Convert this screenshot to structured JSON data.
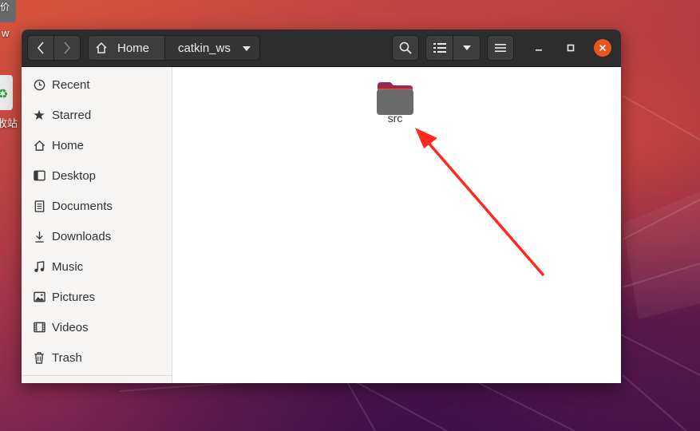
{
  "desktop": {
    "partial_label_top": "w",
    "partial_label_trash": "收站",
    "partial_label_top_glyph": "价"
  },
  "window": {
    "breadcrumb": [
      {
        "label": "Home"
      },
      {
        "label": "catkin_ws"
      }
    ],
    "accent_color": "#e95420"
  },
  "sidebar": {
    "items": [
      {
        "label": "Recent",
        "icon": "clock-icon"
      },
      {
        "label": "Starred",
        "icon": "star-icon"
      },
      {
        "label": "Home",
        "icon": "home-icon"
      },
      {
        "label": "Desktop",
        "icon": "desktop-icon"
      },
      {
        "label": "Documents",
        "icon": "document-icon"
      },
      {
        "label": "Downloads",
        "icon": "download-icon"
      },
      {
        "label": "Music",
        "icon": "music-icon"
      },
      {
        "label": "Pictures",
        "icon": "picture-icon"
      },
      {
        "label": "Videos",
        "icon": "video-icon"
      },
      {
        "label": "Trash",
        "icon": "trash-icon"
      }
    ]
  },
  "content": {
    "files": [
      {
        "name": "src",
        "type": "folder"
      }
    ]
  },
  "annotation": {
    "arrow_color": "#ff2a1f"
  }
}
